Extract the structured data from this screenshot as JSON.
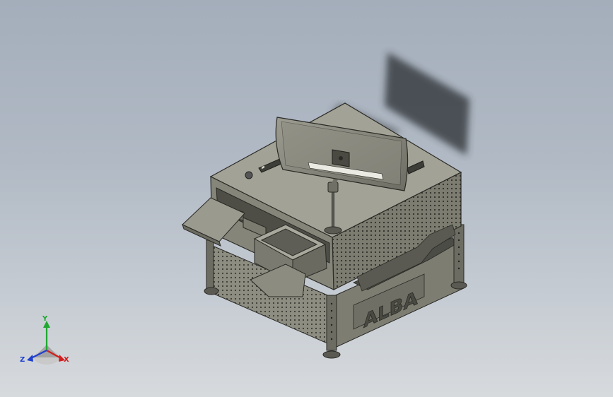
{
  "viewport": {
    "background_top": "#a4aebb",
    "background_bottom": "#d7dadd"
  },
  "model": {
    "brand_text": "ALBA",
    "body_color": "#8b8b7f",
    "body_dark": "#5f5f57",
    "body_light": "#a4a498",
    "edge_color": "#2a2a26"
  },
  "triad": {
    "x_label": "X",
    "y_label": "Y",
    "z_label": "Z",
    "x_color": "#d11f1f",
    "y_color": "#1fa82f",
    "z_color": "#1f3fd1"
  }
}
